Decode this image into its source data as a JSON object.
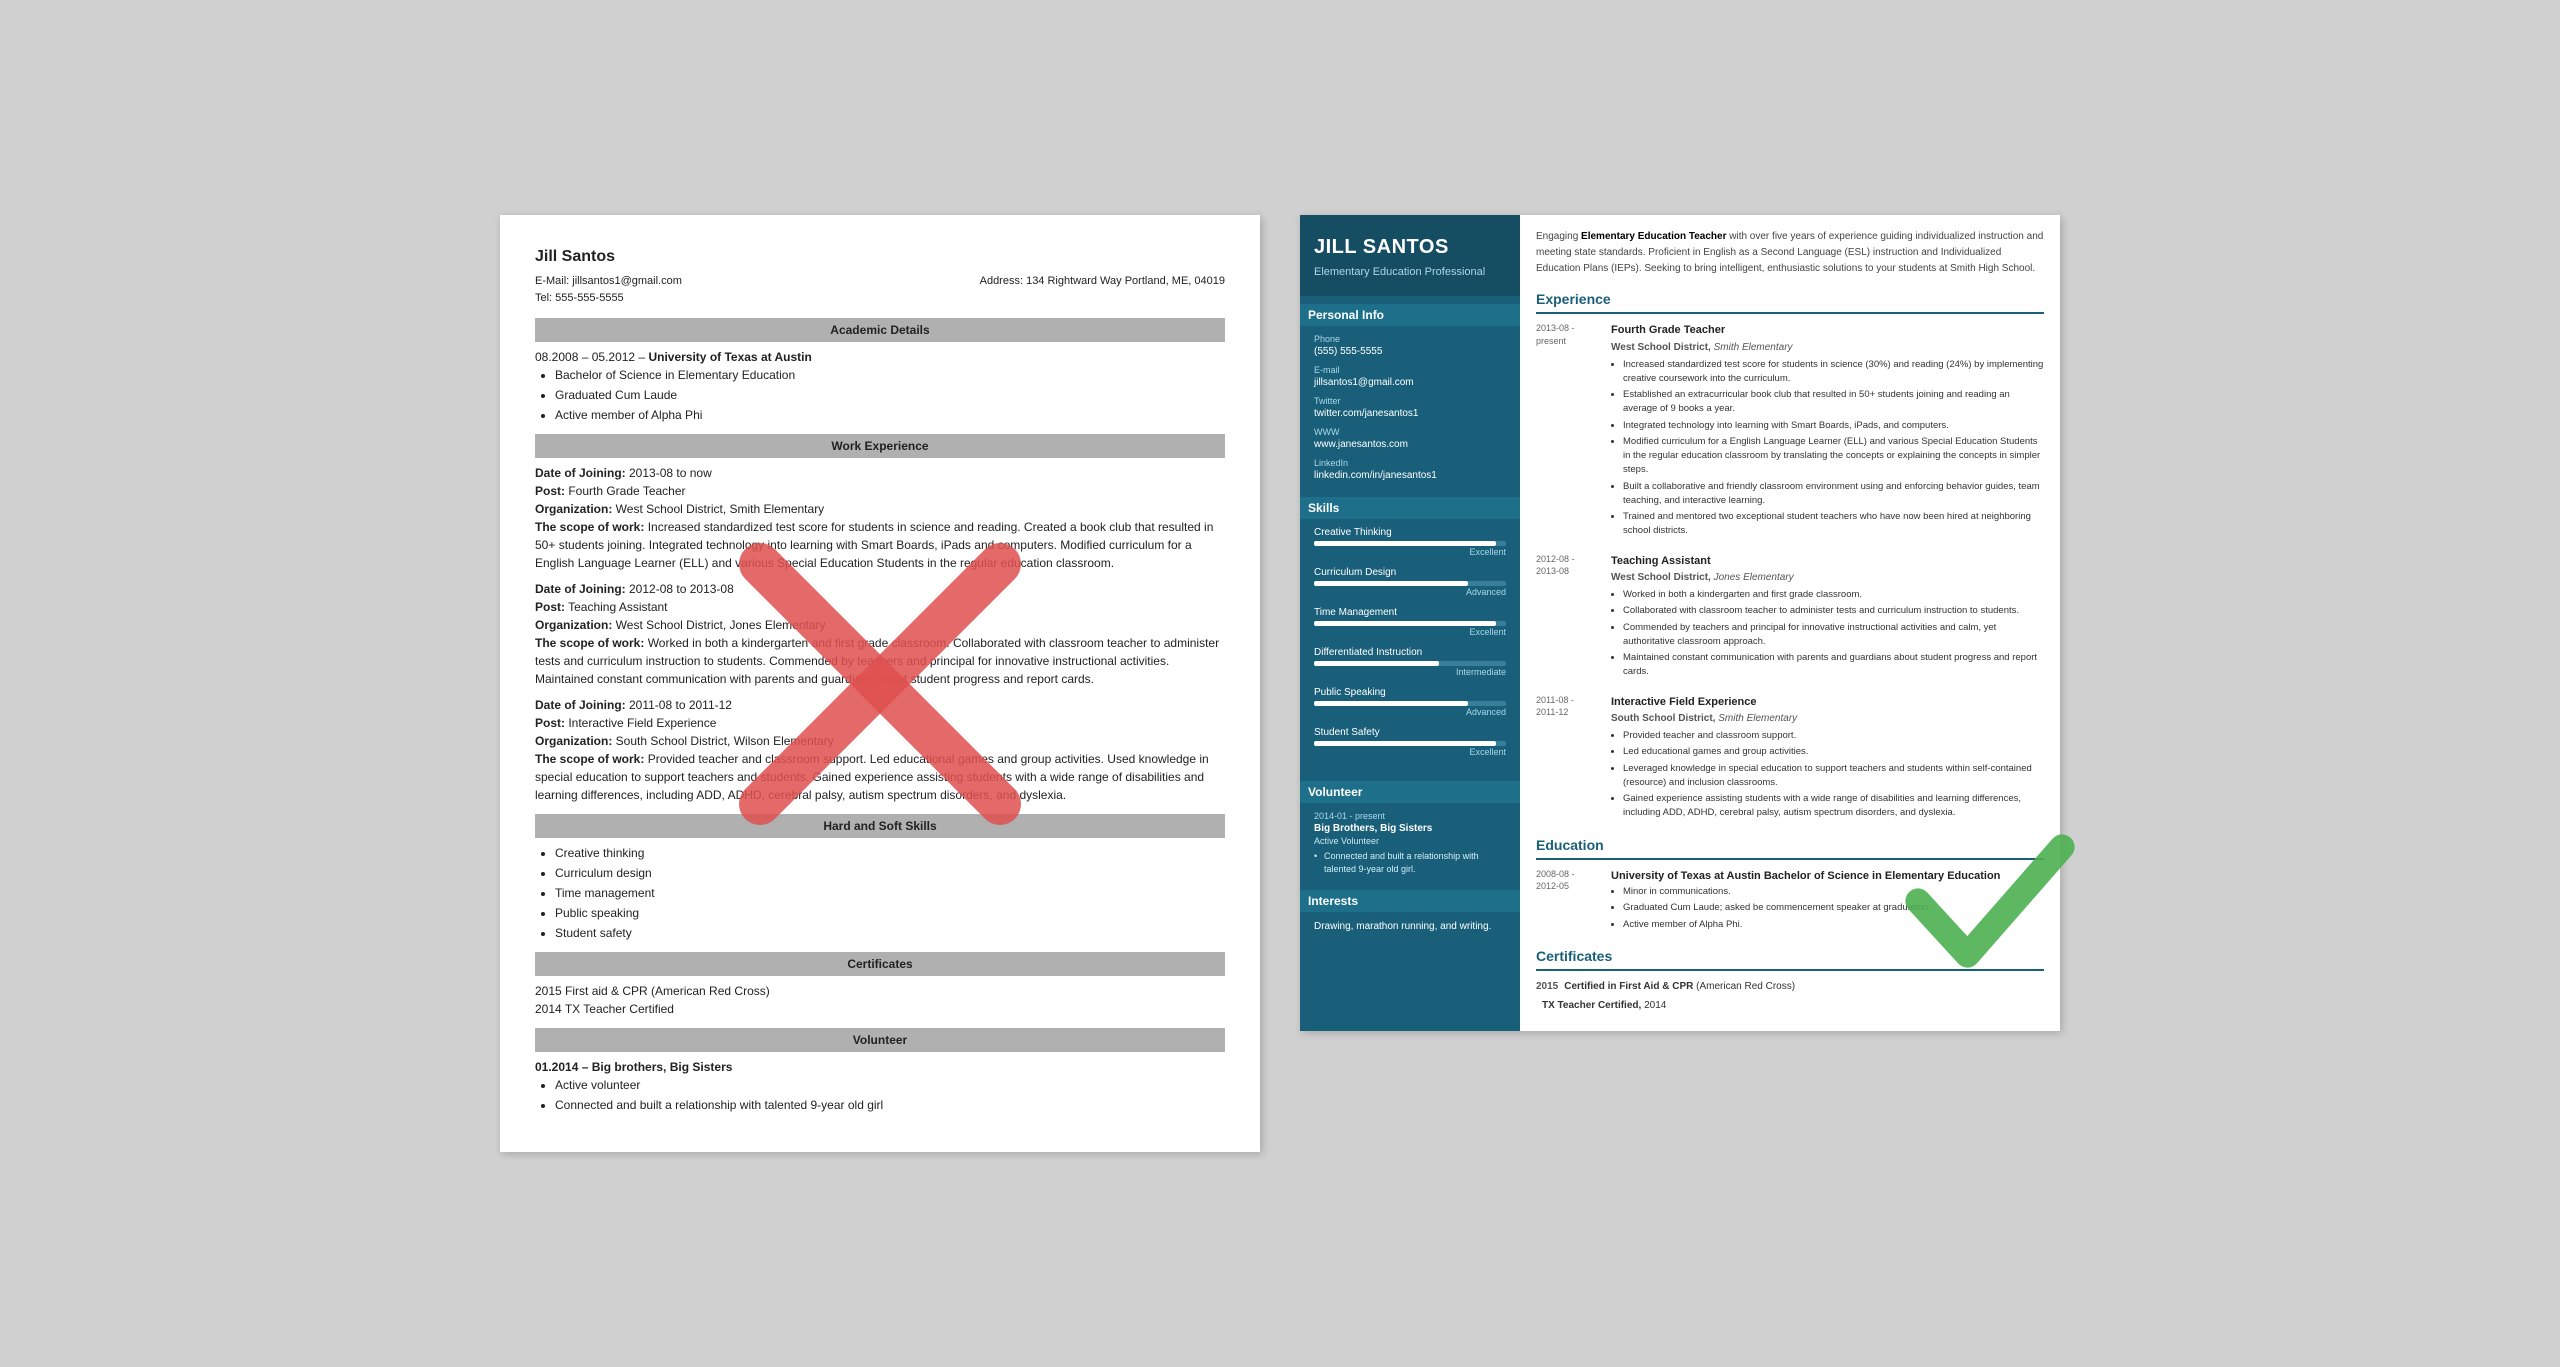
{
  "plain": {
    "name": "Jill Santos",
    "email": "E-Mail: jillsantos1@gmail.com",
    "tel": "Tel: 555-555-5555",
    "address": "Address: 134 Rightward Way Portland, ME, 04019",
    "sections": {
      "academic": "Academic Details",
      "work": "Work Experience",
      "skills_section": "Hard and Soft Skills",
      "certs_section": "Certificates",
      "volunteer_section": "Volunteer"
    },
    "academic": {
      "dates": "08.2008 – 05.2012 –",
      "school": "University of Texas at Austin",
      "degree": "Bachelor of Science in Elementary Education",
      "honor1": "Graduated Cum Laude",
      "honor2": "Active member of Alpha Phi"
    },
    "work": [
      {
        "date_join": "Date of Joining:",
        "dates": "2013-08 to now",
        "post_label": "Post:",
        "post": "Fourth Grade Teacher",
        "org_label": "Organization:",
        "org": "West School District, Smith Elementary",
        "scope_label": "The scope of work:",
        "scope": "Increased standardized test score for students in science and reading. Created a book club that resulted in 50+ students joining. Integrated technology into learning with Smart Boards, iPads and computers. Modified curriculum for a English Language Learner (ELL) and various Special Education Students in the regular education classroom."
      },
      {
        "date_join": "Date of Joining:",
        "dates": "2012-08 to 2013-08",
        "post_label": "Post:",
        "post": "Teaching Assistant",
        "org_label": "Organization:",
        "org": "West School District, Jones Elementary",
        "scope_label": "The scope of work:",
        "scope": "Worked in both a kindergarten and first grade classroom. Collaborated with classroom teacher to administer tests and curriculum instruction to students. Commended by teachers and principal for innovative instructional activities. Maintained constant communication with parents and guardians about student progress and report cards."
      },
      {
        "date_join": "Date of Joining:",
        "dates": "2011-08 to 2011-12",
        "post_label": "Post:",
        "post": "Interactive Field Experience",
        "org_label": "Organization:",
        "org": "South School District, Wilson Elementary",
        "scope_label": "The scope of work:",
        "scope": "Provided teacher and classroom support. Led educational games and group activities. Used knowledge in special education to support teachers and students. Gained experience assisting students with a wide range of disabilities and learning differences, including ADD, ADHD, cerebral palsy, autism spectrum disorders, and dyslexia."
      }
    ],
    "skills": [
      "Creative thinking",
      "Curriculum design",
      "Time management",
      "Public speaking",
      "Student safety"
    ],
    "certs": [
      "2015 First aid & CPR (American Red Cross)",
      "2014 TX Teacher Certified"
    ],
    "volunteer": {
      "dates": "01.2014 – Big brothers, Big Sisters",
      "bullets": [
        "Active volunteer",
        "Connected and built a relationship with talented 9-year old girl"
      ]
    }
  },
  "styled": {
    "name": "JILL SANTOS",
    "title": "Elementary Education Professional",
    "summary": "Engaging Elementary Education Teacher with over five years of experience guiding individualized instruction and meeting state standards. Proficient in English as a Second Language (ESL) instruction and Individualized Education Plans (IEPs). Seeking to bring intelligent, enthusiastic solutions to your students at Smith High School.",
    "sidebar": {
      "personal_info_title": "Personal Info",
      "phone_label": "Phone",
      "phone": "(555) 555-5555",
      "email_label": "E-mail",
      "email": "jillsantos1@gmail.com",
      "twitter_label": "Twitter",
      "twitter": "twitter.com/janesantos1",
      "www_label": "WWW",
      "www": "www.janesantos.com",
      "linkedin_label": "LinkedIn",
      "linkedin": "linkedin.com/in/janesantos1",
      "skills_title": "Skills",
      "skills": [
        {
          "name": "Creative Thinking",
          "level": "Excellent",
          "pct": 95
        },
        {
          "name": "Curriculum Design",
          "level": "Advanced",
          "pct": 80
        },
        {
          "name": "Time Management",
          "level": "Excellent",
          "pct": 95
        },
        {
          "name": "Differentiated Instruction",
          "level": "Intermediate",
          "pct": 65
        },
        {
          "name": "Public Speaking",
          "level": "Advanced",
          "pct": 80
        },
        {
          "name": "Student Safety",
          "level": "Excellent",
          "pct": 95
        }
      ],
      "volunteer_title": "Volunteer",
      "volunteer_dates": "2014-01 - present",
      "volunteer_org": "Big Brothers, Big Sisters",
      "volunteer_role": "Active Volunteer",
      "volunteer_bullets": [
        "Connected and built a relationship with talented 9-year old girl."
      ],
      "interests_title": "Interests",
      "interests": "Drawing, marathon running, and writing."
    },
    "experience_title": "Experience",
    "experience": [
      {
        "dates": "2013-08 -\npresent",
        "title": "Fourth Grade Teacher",
        "org": "West School District,",
        "org_italic": "Smith Elementary",
        "bullets": [
          "Increased standardized test score for students in science (30%) and reading (24%) by implementing creative coursework into the curriculum.",
          "Established an extracurricular book club that resulted in 50+ students joining and reading an average of 9 books a year.",
          "Integrated technology into learning with Smart Boards, iPads, and computers.",
          "Modified curriculum for a English Language Learner (ELL) and various Special Education Students in the regular education classroom by translating the concepts or explaining the concepts in simpler steps.",
          "Built a collaborative and friendly classroom environment using and enforcing behavior guides, team teaching, and interactive learning.",
          "Trained and mentored two exceptional student teachers who have now been hired at neighboring school districts."
        ]
      },
      {
        "dates": "2012-08 -\n2013-08",
        "title": "Teaching Assistant",
        "org": "West School District,",
        "org_italic": "Jones Elementary",
        "bullets": [
          "Worked in both a kindergarten and first grade classroom.",
          "Collaborated with classroom teacher to administer tests and curriculum instruction to students.",
          "Commended by teachers and principal for innovative instructional activities and calm, yet authoritative classroom approach.",
          "Maintained constant communication with parents and guardians about student progress and report cards."
        ]
      },
      {
        "dates": "2011-08 -\n2011-12",
        "title": "Interactive Field Experience",
        "org": "South School District,",
        "org_italic": "Smith Elementary",
        "bullets": [
          "Provided teacher and classroom support.",
          "Led educational games and group activities.",
          "Leveraged knowledge in special education to support teachers and students within self-contained (resource) and inclusion classrooms.",
          "Gained experience assisting students with a wide range of disabilities and learning differences, including ADD, ADHD, cerebral palsy, autism spectrum disorders, and dyslexia."
        ]
      }
    ],
    "education_title": "Education",
    "education": [
      {
        "dates": "2008-08 -\n2012-05",
        "school": "University of Texas at Austin",
        "degree": "Bachelor of Science in Elementary Education",
        "bullets": [
          "Minor in communications.",
          "Graduated Cum Laude; asked be commencement speaker at graduation.",
          "Active member of Alpha Phi."
        ]
      }
    ],
    "certs_title": "Certificates",
    "certs": [
      {
        "year": "2015",
        "text": "Certified in First Aid & CPR",
        "sub": "(American Red Cross)"
      },
      {
        "year": "",
        "text": "TX Teacher Certified,",
        "sub": "2014"
      }
    ]
  }
}
